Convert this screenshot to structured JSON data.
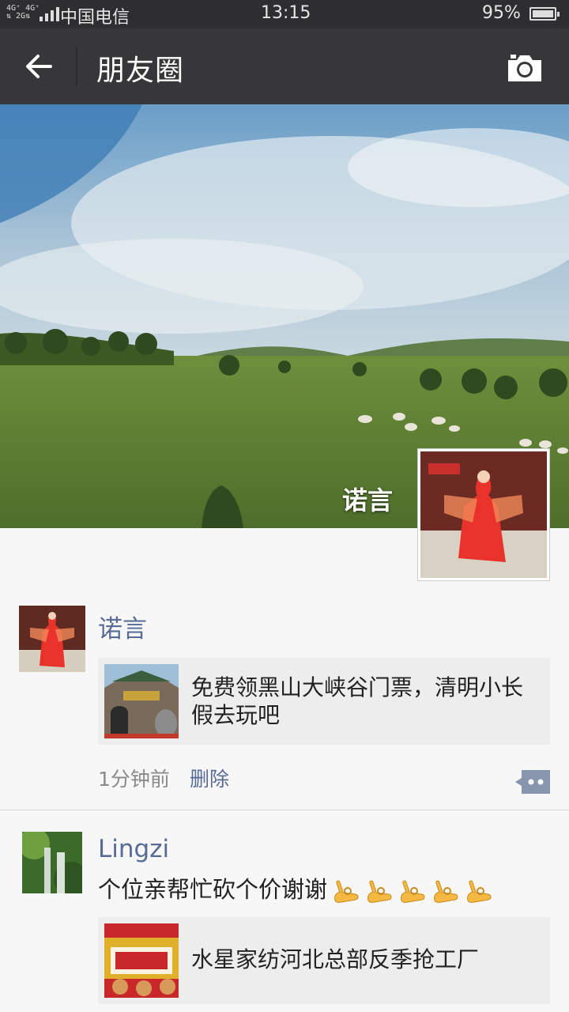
{
  "status_bar": {
    "network_top": "4G⁺ 4G⁺",
    "network_bottom": "⇅ 2G⇅",
    "carrier": "中国电信",
    "time": "13:15",
    "battery": "95%",
    "battery_level": 0.95
  },
  "nav": {
    "back_icon": "arrow-left-icon",
    "title": "朋友圈",
    "camera_icon": "camera-icon"
  },
  "cover": {
    "name": "诺言"
  },
  "posts": [
    {
      "name": "诺言",
      "link_text": "免费领黑山大峡谷门票，清明小长假去玩吧",
      "time": "1分钟前",
      "delete_label": "删除",
      "more_icon": "comment-more-icon"
    },
    {
      "name": "Lingzi",
      "text": "个位亲帮忙砍个价谢谢",
      "emoji_icon": "ok-hand-icon",
      "emoji_count": 5,
      "link_text": "水星家纺河北总部反季抢工厂"
    }
  ],
  "colors": {
    "status_bg": "#2e2e31",
    "nav_bg": "#37373a",
    "name_link": "#576b95",
    "page_bg": "#f7f7f7",
    "link_bg": "#ededed"
  }
}
